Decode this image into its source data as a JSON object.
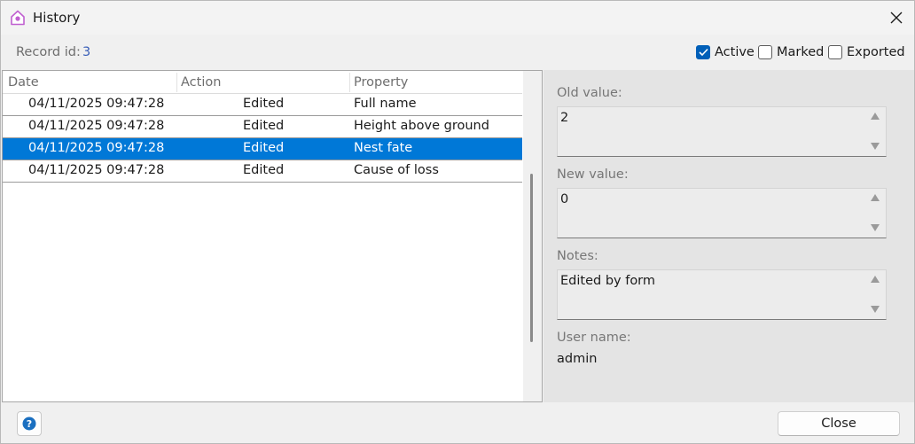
{
  "window": {
    "title": "History"
  },
  "header": {
    "record_label": "Record id:",
    "record_value": "3",
    "checkboxes": [
      {
        "label": "Active",
        "checked": true
      },
      {
        "label": "Marked",
        "checked": false
      },
      {
        "label": "Exported",
        "checked": false
      }
    ]
  },
  "grid": {
    "columns": [
      "Date",
      "Action",
      "Property"
    ],
    "rows": [
      {
        "date": "04/11/2025 09:47:28",
        "action": "Edited",
        "property": "Full name",
        "selected": false
      },
      {
        "date": "04/11/2025 09:47:28",
        "action": "Edited",
        "property": "Height above ground",
        "selected": false
      },
      {
        "date": "04/11/2025 09:47:28",
        "action": "Edited",
        "property": "Nest fate",
        "selected": true
      },
      {
        "date": "04/11/2025 09:47:28",
        "action": "Edited",
        "property": "Cause of loss",
        "selected": false
      }
    ]
  },
  "details": {
    "old_value_label": "Old value:",
    "old_value": "2",
    "new_value_label": "New value:",
    "new_value": "0",
    "notes_label": "Notes:",
    "notes": "Edited by form",
    "user_label": "User name:",
    "user_value": "admin"
  },
  "footer": {
    "help_icon": "help-icon",
    "close_label": "Close"
  },
  "colors": {
    "accent": "#005fb8",
    "selection": "#0078d7",
    "record_value": "#3a5fb8"
  }
}
